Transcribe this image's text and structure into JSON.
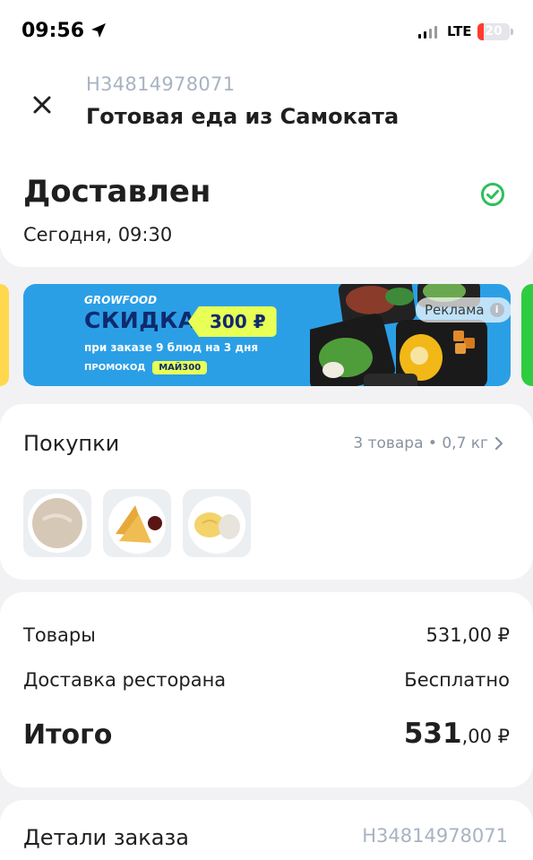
{
  "status_bar": {
    "time": "09:56",
    "network": "LTE",
    "battery": "20",
    "battery_level": 0.2,
    "location_icon": "location-arrow-icon",
    "signal_icon": "cell-signal-icon"
  },
  "header": {
    "order_number": "H34814978071",
    "title": "Готовая еда из Самоката",
    "close_icon": "close-icon"
  },
  "status": {
    "title": "Доставлен",
    "time": "Сегодня, 09:30",
    "icon": "check-circle-icon",
    "icon_color": "#2dbf5a"
  },
  "banner": {
    "brand": "GROWFOOD",
    "discount": "СКИДКА",
    "amount": "300 ₽",
    "condition": "при заказе 9 блюд на 3 дня",
    "promo_label": "ПРОМОКОД",
    "promo_code": "МАЙ300",
    "ad_label": "Реклама",
    "info_icon": "info-icon",
    "colors": {
      "background": "#2b9fe6",
      "accent": "#e8ff55",
      "text": "#0f2a6e"
    }
  },
  "purchases": {
    "title": "Покупки",
    "summary": "3 товара • 0,7 кг",
    "chevron_icon": "chevron-right-icon",
    "items": [
      {
        "name": "porridge-thumbnail"
      },
      {
        "name": "pancakes-thumbnail"
      },
      {
        "name": "mashed-potato-thumbnail"
      }
    ]
  },
  "totals": {
    "goods_label": "Товары",
    "goods_value": "531,00 ₽",
    "delivery_label": "Доставка ресторана",
    "delivery_value": "Бесплатно",
    "total_label": "Итого",
    "total_int": "531",
    "total_frac": ",00 ₽"
  },
  "details": {
    "title": "Детали заказа",
    "order_number": "H34814978071"
  }
}
